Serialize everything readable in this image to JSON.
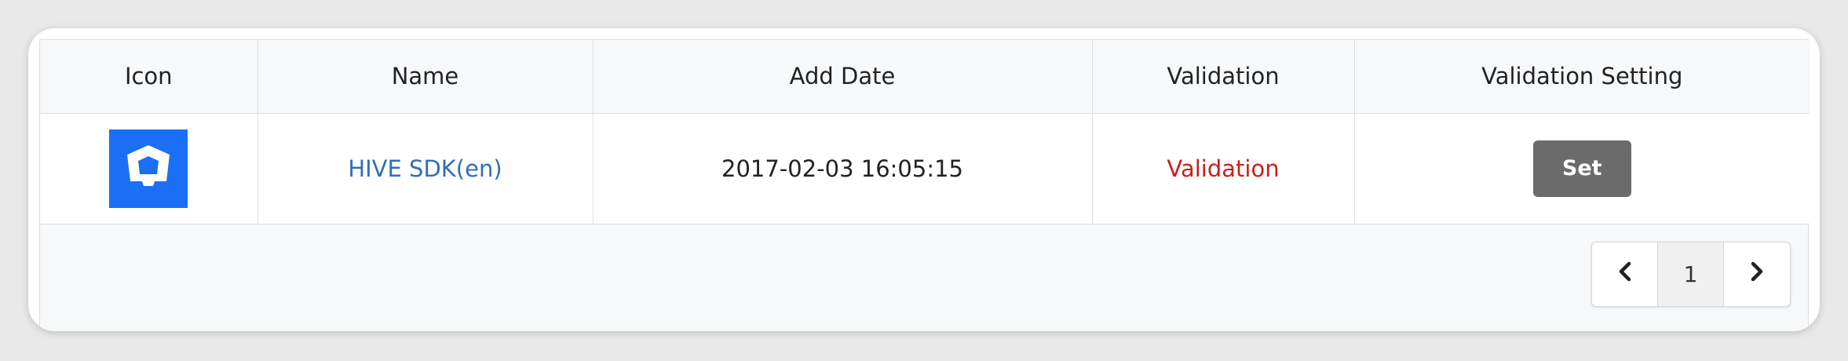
{
  "table": {
    "headers": [
      "Icon",
      "Name",
      "Add Date",
      "Validation",
      "Validation Setting"
    ],
    "rows": [
      {
        "icon": "hive-shield-icon",
        "icon_color": "#1a6ff5",
        "name": "HIVE SDK(en)",
        "add_date": "2017-02-03 16:05:15",
        "validation": "Validation",
        "setting_button": "Set"
      }
    ]
  },
  "pagination": {
    "prev_icon": "chevron-left-icon",
    "current_page": "1",
    "next_icon": "chevron-right-icon"
  },
  "colors": {
    "link": "#2f6fb5",
    "validation": "#c81e1e",
    "button": "#6b6b6b"
  }
}
